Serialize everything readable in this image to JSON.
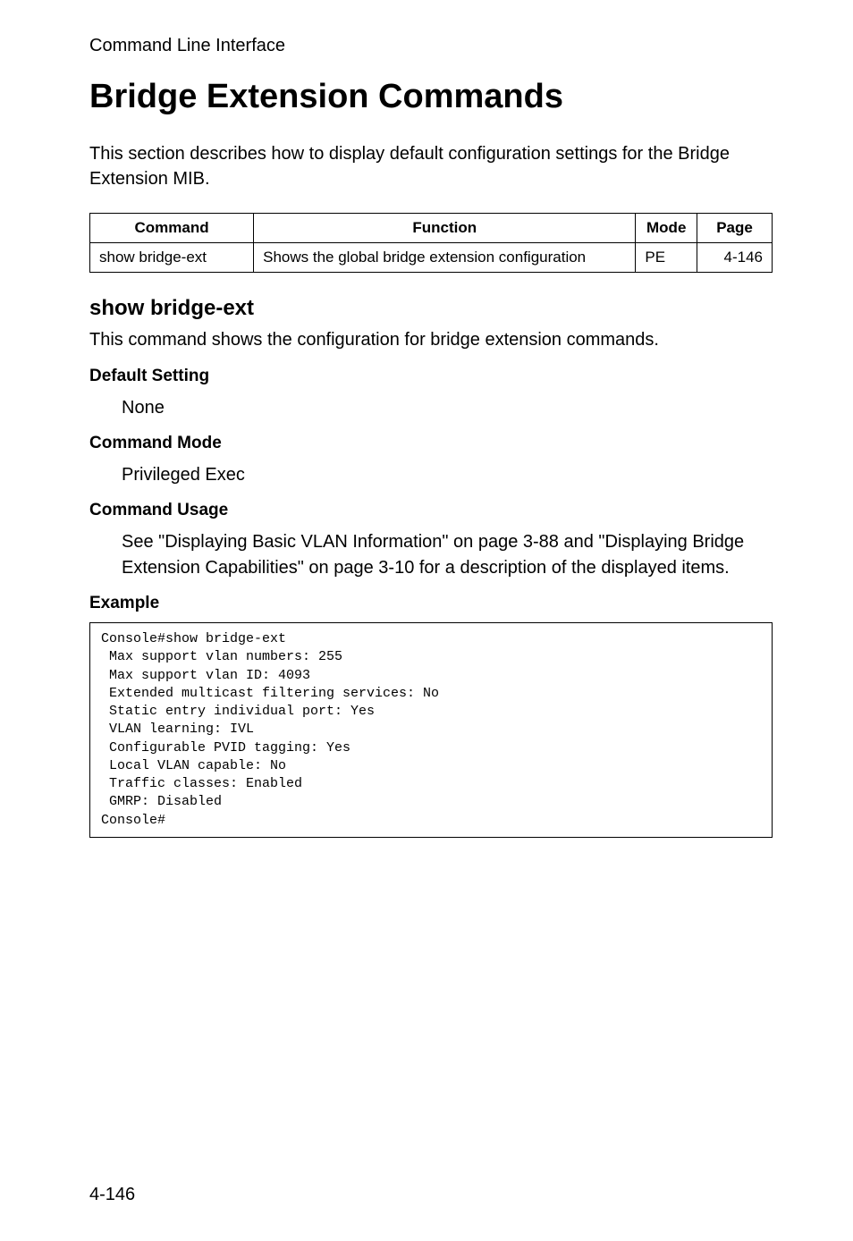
{
  "breadcrumb": "Command Line Interface",
  "title": "Bridge Extension Commands",
  "intro": "This section describes how to display default configuration settings for the Bridge Extension MIB.",
  "table": {
    "headers": {
      "command": "Command",
      "function": "Function",
      "mode": "Mode",
      "page": "Page"
    },
    "rows": [
      {
        "command": "show bridge-ext",
        "function": "Shows the global bridge extension configuration",
        "mode": "PE",
        "page": "4-146"
      }
    ]
  },
  "subheading": "show bridge-ext",
  "command_desc": "This command shows the configuration for bridge extension commands.",
  "sections": {
    "default_setting": {
      "label": "Default Setting",
      "value": "None"
    },
    "command_mode": {
      "label": "Command Mode",
      "value": "Privileged Exec"
    },
    "command_usage": {
      "label": "Command Usage",
      "value": "See \"Displaying Basic VLAN Information\" on page 3-88 and \"Displaying Bridge Extension Capabilities\" on page 3-10 for a description of the displayed items."
    },
    "example": {
      "label": "Example"
    }
  },
  "code_block": "Console#show bridge-ext\n Max support vlan numbers: 255\n Max support vlan ID: 4093\n Extended multicast filtering services: No\n Static entry individual port: Yes\n VLAN learning: IVL\n Configurable PVID tagging: Yes\n Local VLAN capable: No\n Traffic classes: Enabled\n GMRP: Disabled\nConsole#",
  "page_number": "4-146"
}
